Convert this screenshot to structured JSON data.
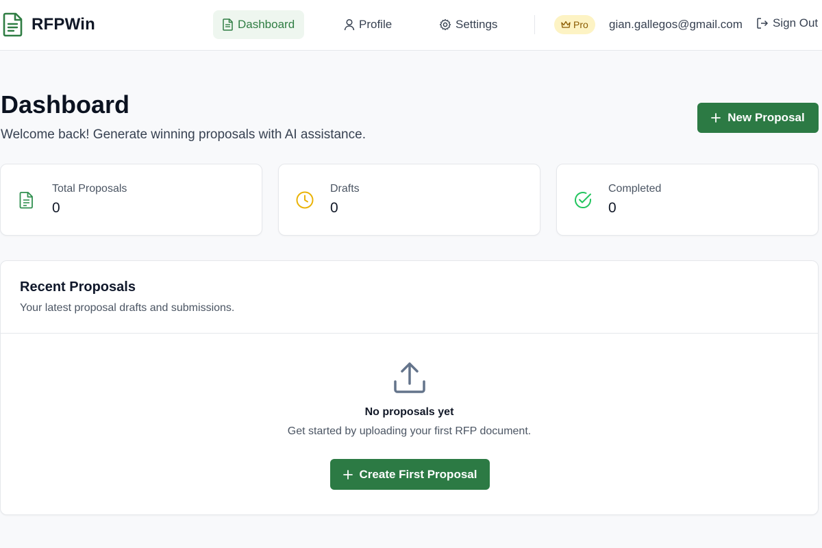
{
  "brand": {
    "name": "RFPWin",
    "icon": "document-icon",
    "accent": "#2c7a44"
  },
  "nav": {
    "items": [
      {
        "label": "Dashboard",
        "icon": "document-icon",
        "active": true
      },
      {
        "label": "Profile",
        "icon": "user-icon",
        "active": false
      },
      {
        "label": "Settings",
        "icon": "gear-icon",
        "active": false
      }
    ]
  },
  "account": {
    "plan_badge": "Pro",
    "plan_icon": "crown-icon",
    "email": "gian.gallegos@gmail.com",
    "signout_label": "Sign Out"
  },
  "header": {
    "title": "Dashboard",
    "subtitle": "Welcome back! Generate winning proposals with AI assistance.",
    "new_proposal_label": "New Proposal"
  },
  "stats": [
    {
      "label": "Total Proposals",
      "value": "0",
      "icon": "document-icon",
      "color": "#2f8f4e"
    },
    {
      "label": "Drafts",
      "value": "0",
      "icon": "clock-icon",
      "color": "#eab308"
    },
    {
      "label": "Completed",
      "value": "0",
      "icon": "check-circle-icon",
      "color": "#22c55e"
    }
  ],
  "recent": {
    "title": "Recent Proposals",
    "subtitle": "Your latest proposal drafts and submissions.",
    "empty_title": "No proposals yet",
    "empty_subtitle": "Get started by uploading your first RFP document.",
    "create_label": "Create First Proposal",
    "empty_icon": "upload-icon"
  }
}
